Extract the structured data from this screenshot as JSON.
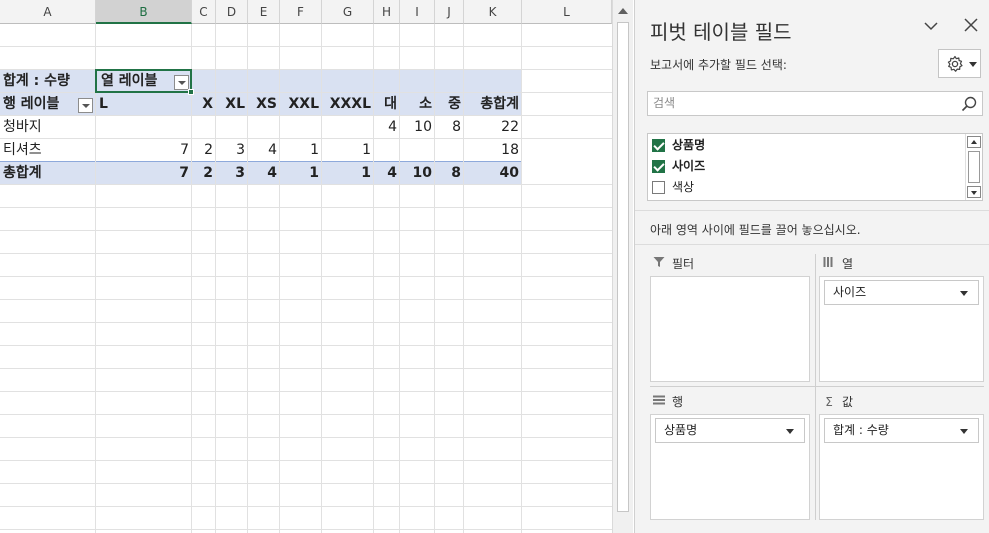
{
  "sheet": {
    "columns": [
      "A",
      "B",
      "C",
      "D",
      "E",
      "F",
      "G",
      "H",
      "I",
      "J",
      "K",
      "L"
    ],
    "selected_column": "B",
    "pivot": {
      "value_header": "합계 : 수량",
      "col_labels_header": "열 레이블",
      "row_labels_header": "행 레이블",
      "sizes": [
        "L",
        "X",
        "XL",
        "XS",
        "XXL",
        "XXXL",
        "대",
        "소",
        "중"
      ],
      "grand_total_label": "총합계",
      "rows": [
        {
          "label": "청바지",
          "values": [
            "",
            "",
            "",
            "",
            "",
            "",
            "4",
            "10",
            "8"
          ],
          "total": "22"
        },
        {
          "label": "티셔츠",
          "values": [
            "7",
            "2",
            "3",
            "4",
            "1",
            "1",
            "",
            "",
            ""
          ],
          "total": "18"
        }
      ],
      "grand_total": {
        "label": "총합계",
        "values": [
          "7",
          "2",
          "3",
          "4",
          "1",
          "1",
          "4",
          "10",
          "8"
        ],
        "total": "40"
      }
    },
    "accent": "#217346",
    "band_color": "#d9e1f2"
  },
  "pane": {
    "title": "피벗 테이블 필드",
    "subtitle": "보고서에 추가할 필드 선택:",
    "search_placeholder": "검색",
    "fields": [
      {
        "label": "상품명",
        "checked": true
      },
      {
        "label": "사이즈",
        "checked": true
      },
      {
        "label": "색상",
        "checked": false
      }
    ],
    "hint": "아래 영역 사이에 필드를 끌어 놓으십시오.",
    "areas": {
      "filter": {
        "title": "필터",
        "items": []
      },
      "columns": {
        "title": "열",
        "items": [
          "사이즈"
        ]
      },
      "rows": {
        "title": "행",
        "items": [
          "상품명"
        ]
      },
      "values": {
        "title": "값",
        "items": [
          "합계 : 수량"
        ]
      }
    }
  }
}
